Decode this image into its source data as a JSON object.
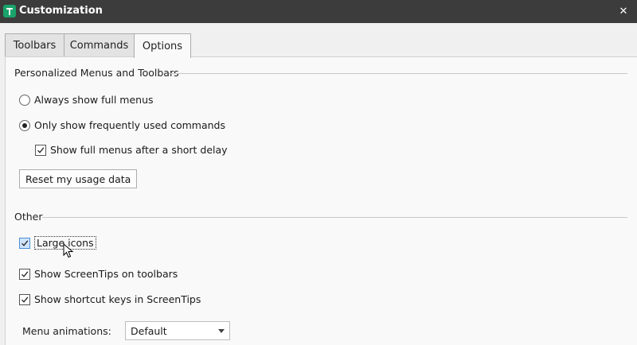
{
  "window": {
    "title": "Customization",
    "close_glyph": "✕",
    "app_icon": "customization-app-icon"
  },
  "tabs": [
    {
      "label": "Toolbars",
      "active": false
    },
    {
      "label": "Commands",
      "active": false
    },
    {
      "label": "Options",
      "active": true
    }
  ],
  "personalized": {
    "heading": "Personalized Menus and Toolbars",
    "radio_always": {
      "label": "Always show full menus",
      "checked": false
    },
    "radio_frequent": {
      "label": "Only show frequently used commands",
      "checked": true
    },
    "check_delay": {
      "label": "Show full menus after a short delay",
      "checked": true
    },
    "reset_button": "Reset my usage data"
  },
  "other": {
    "heading": "Other",
    "large_icons": {
      "label": "Large icons",
      "checked": true
    },
    "screentips": {
      "label": "Show ScreenTips on toolbars",
      "checked": true
    },
    "shortcut_keys": {
      "label": "Show shortcut keys in ScreenTips",
      "checked": true
    },
    "menu_animations": {
      "label": "Menu animations:",
      "value": "Default"
    }
  },
  "colors": {
    "titlebar": "#3c3c3c",
    "app_icon": "#1aa36b",
    "focus_highlight": "#cfe4fb"
  }
}
